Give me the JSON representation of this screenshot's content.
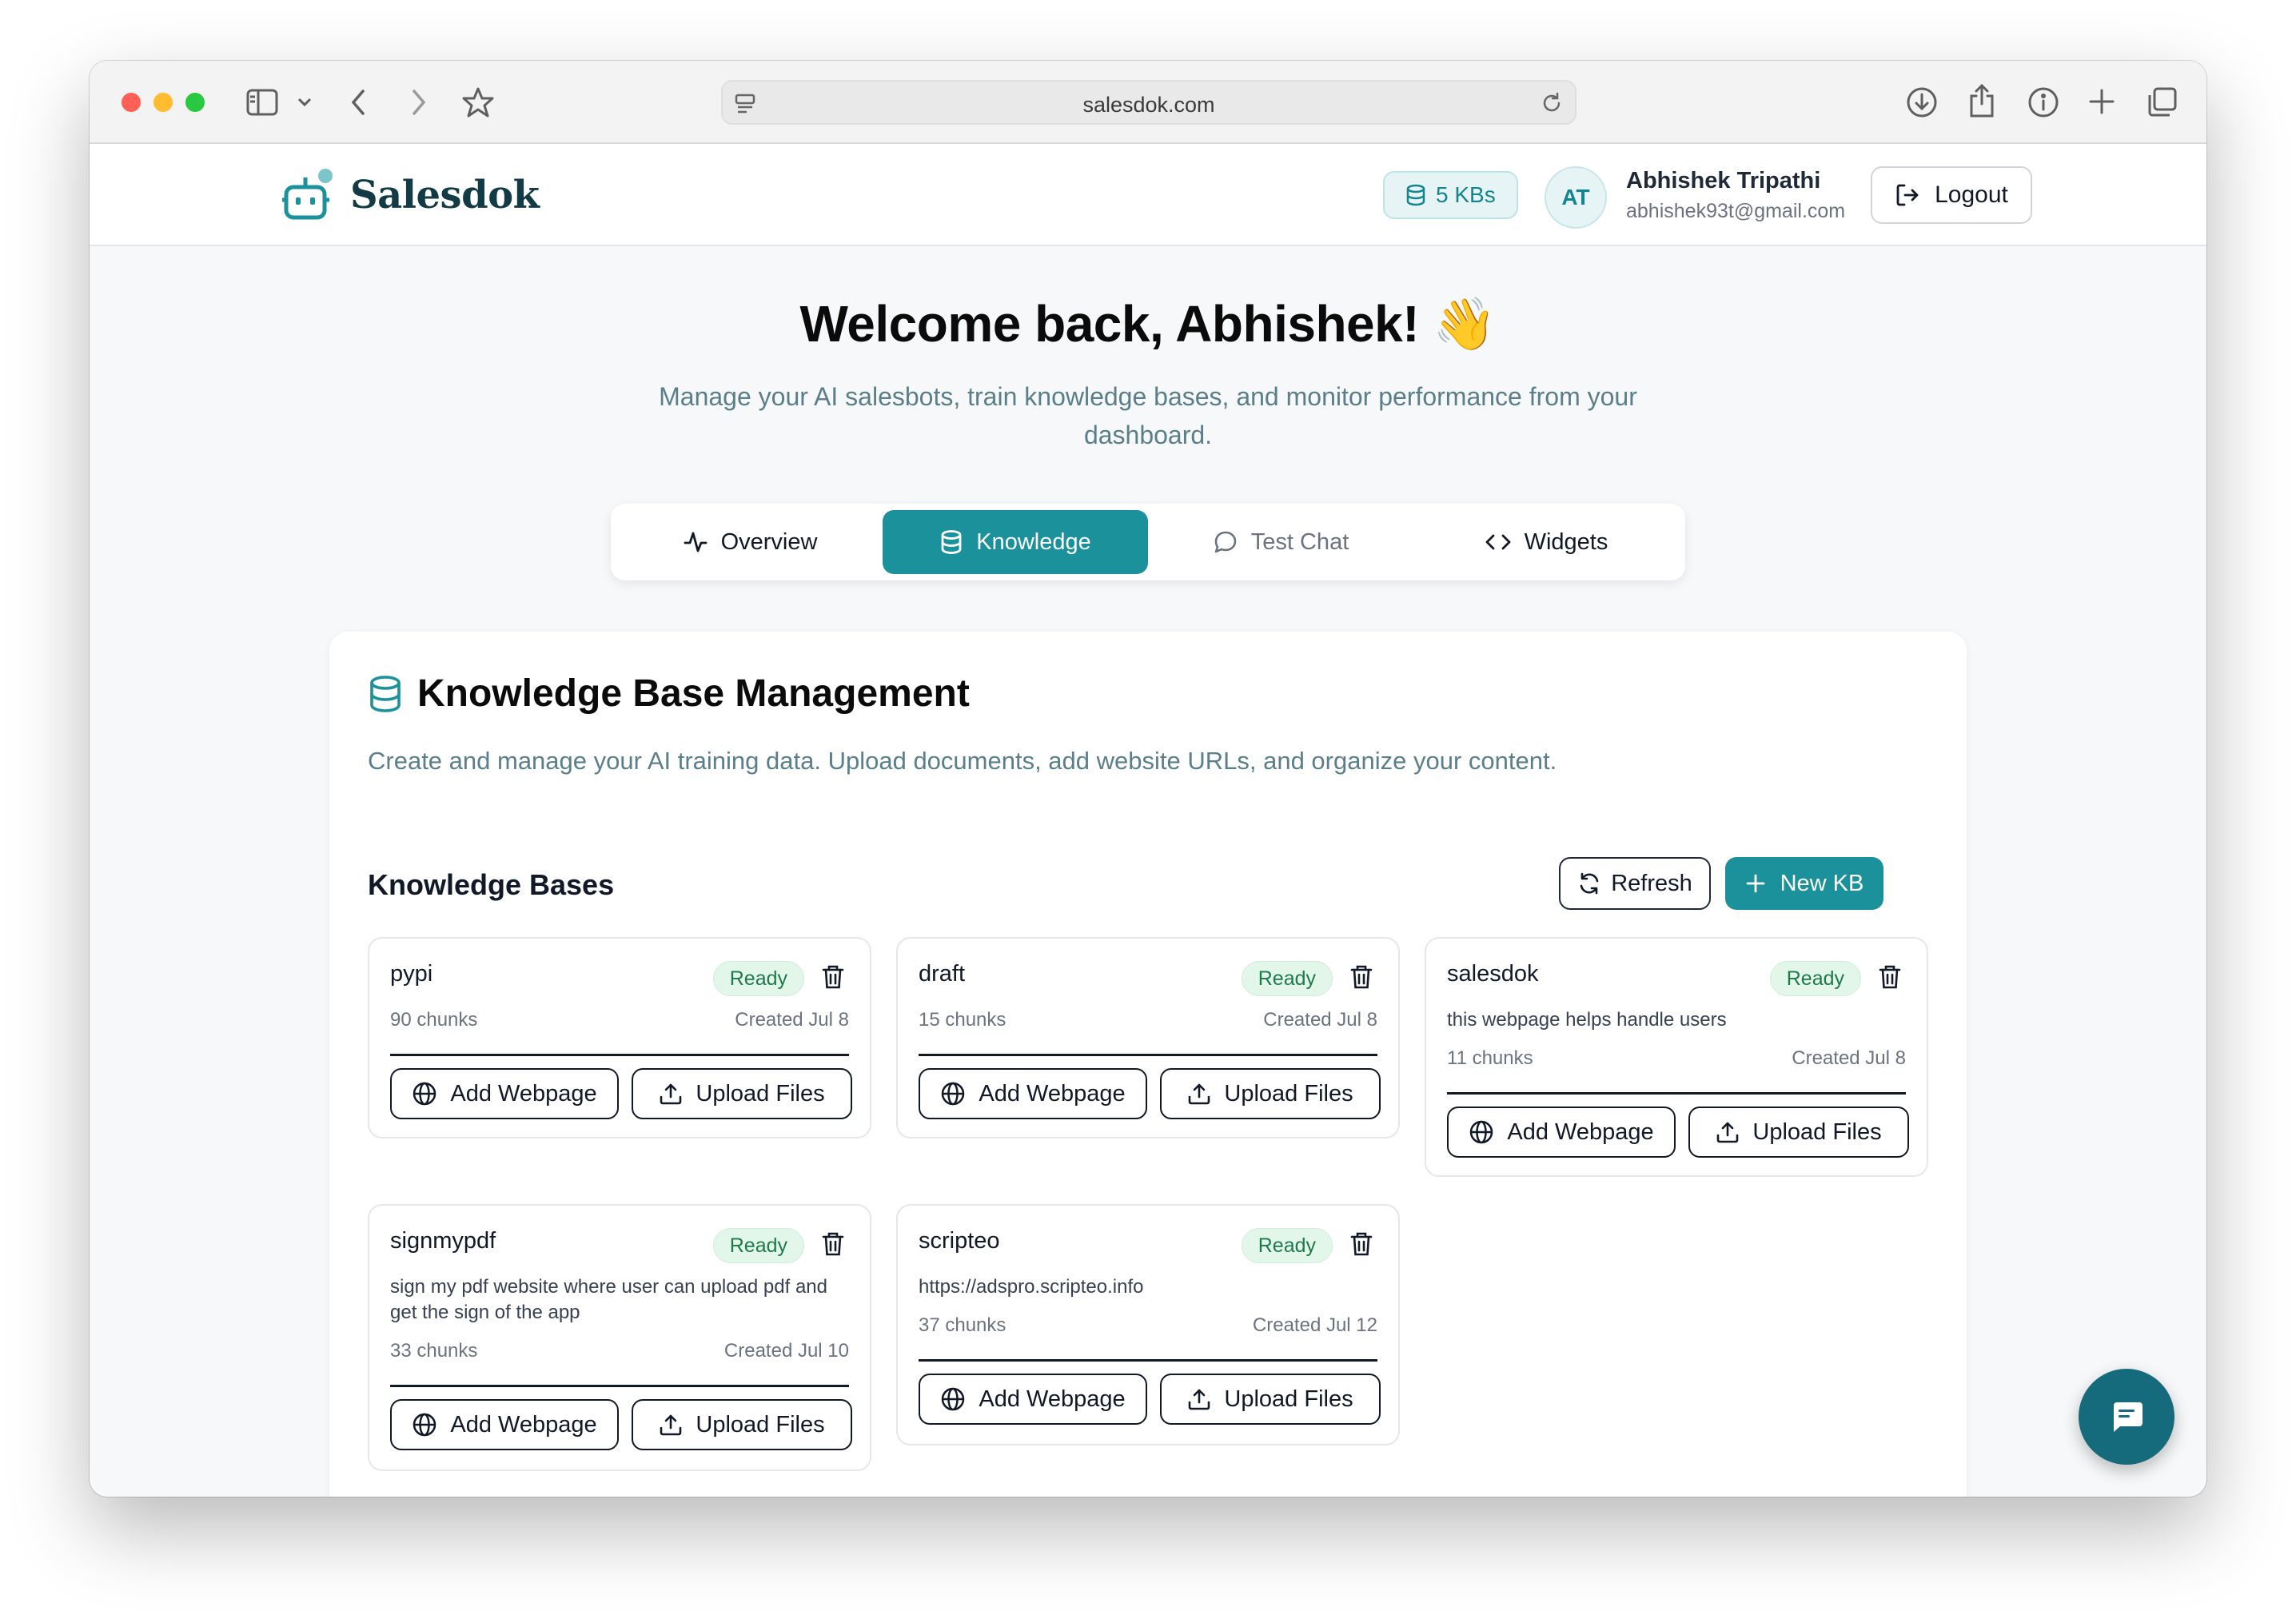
{
  "browser": {
    "address": "salesdok.com"
  },
  "header": {
    "brand": "Salesdok",
    "kb_count": "5 KBs",
    "avatar_initials": "AT",
    "user_name": "Abhishek Tripathi",
    "user_email": "abhishek93t@gmail.com",
    "logout_label": "Logout"
  },
  "hero": {
    "title": "Welcome back, Abhishek! 👋",
    "subtitle": "Manage your AI salesbots, train knowledge bases, and monitor performance from your dashboard."
  },
  "tabs": [
    {
      "label": "Overview",
      "icon": "activity-icon",
      "active": false
    },
    {
      "label": "Knowledge",
      "icon": "database-icon",
      "active": true
    },
    {
      "label": "Test Chat",
      "icon": "message-circle-icon",
      "active": false
    },
    {
      "label": "Widgets",
      "icon": "code-icon",
      "active": false
    }
  ],
  "panel": {
    "title": "Knowledge Base Management",
    "description": "Create and manage your AI training data. Upload documents, add website URLs, and organize your content.",
    "kb_heading": "Knowledge Bases",
    "refresh_label": "Refresh",
    "new_kb_label": "New KB"
  },
  "knowledge_bases": [
    {
      "name": "pypi",
      "status": "Ready",
      "description": "",
      "chunks": "90 chunks",
      "created": "Created Jul 8",
      "add_webpage": "Add Webpage",
      "upload_files": "Upload Files"
    },
    {
      "name": "draft",
      "status": "Ready",
      "description": "",
      "chunks": "15 chunks",
      "created": "Created Jul 8",
      "add_webpage": "Add Webpage",
      "upload_files": "Upload Files"
    },
    {
      "name": "salesdok",
      "status": "Ready",
      "description": "this webpage helps handle users",
      "chunks": "11 chunks",
      "created": "Created Jul 8",
      "add_webpage": "Add Webpage",
      "upload_files": "Upload Files"
    },
    {
      "name": "signmypdf",
      "status": "Ready",
      "description": "sign my pdf website where user can upload pdf and get the sign of the app",
      "chunks": "33 chunks",
      "created": "Created Jul 10",
      "add_webpage": "Add Webpage",
      "upload_files": "Upload Files"
    },
    {
      "name": "scripteo",
      "status": "Ready",
      "description": "https://adspro.scripteo.info",
      "chunks": "37 chunks",
      "created": "Created Jul 12",
      "add_webpage": "Add Webpage",
      "upload_files": "Upload Files"
    }
  ],
  "colors": {
    "accent": "#1a919b",
    "brand_text": "#123b46",
    "ready_badge_bg": "#e3f6ea",
    "ready_badge_text": "#1f7a4a",
    "muted_text": "#5b7f8a",
    "fab": "#156b7c"
  }
}
